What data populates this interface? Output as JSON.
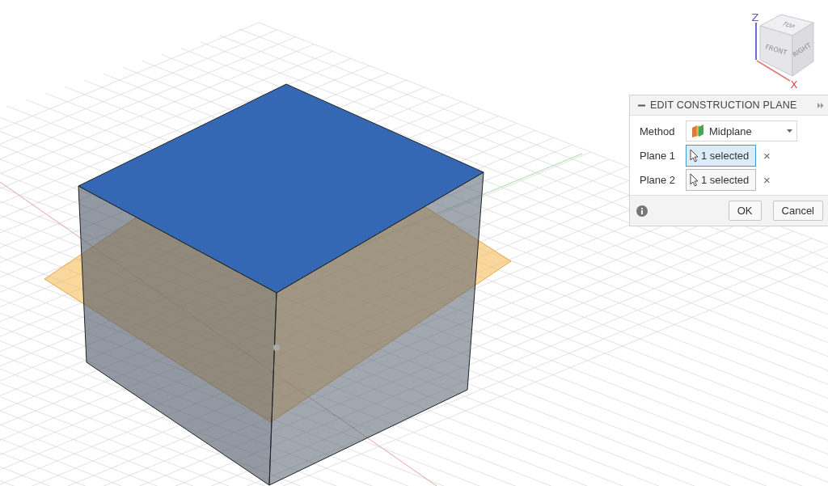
{
  "viewcube": {
    "faces": [
      "TOP",
      "FRONT",
      "RIGHT"
    ],
    "axes": [
      "Z",
      "X"
    ]
  },
  "panel": {
    "title": "EDIT CONSTRUCTION PLANE",
    "rows": [
      {
        "kind": "dropdown",
        "label": "Method",
        "value": "Midplane"
      },
      {
        "kind": "selection",
        "label": "Plane 1",
        "value": "1 selected",
        "selected": true,
        "clear": "×"
      },
      {
        "kind": "selection",
        "label": "Plane 2",
        "value": "1 selected",
        "selected": false,
        "clear": "×"
      }
    ],
    "buttons": [
      "OK",
      "Cancel"
    ]
  }
}
